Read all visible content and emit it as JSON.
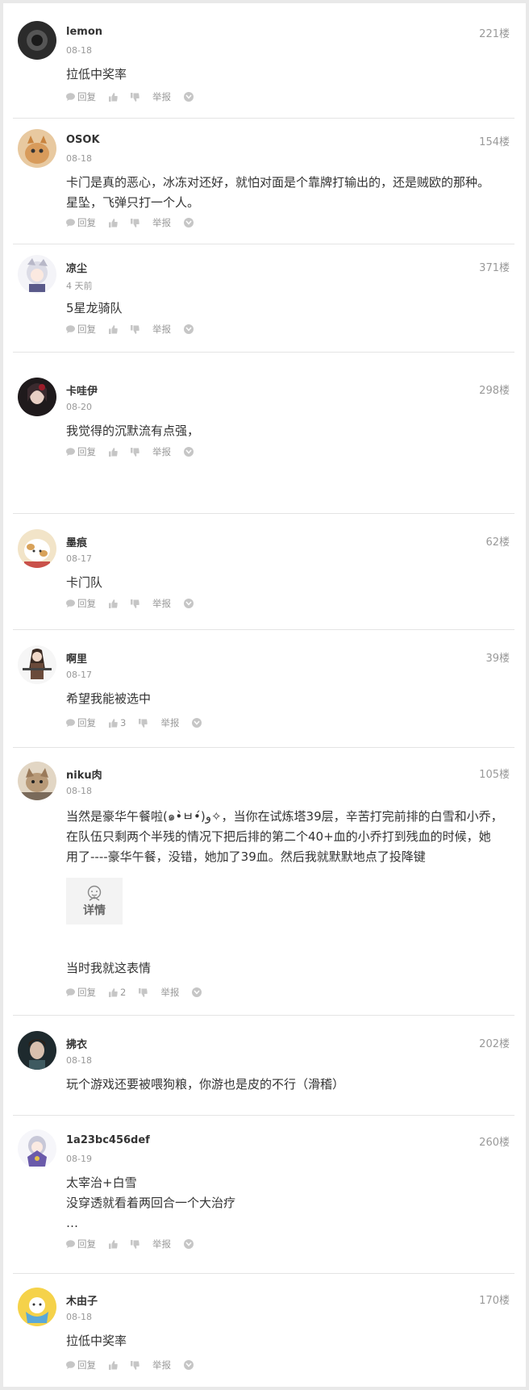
{
  "labels": {
    "reply": "回复",
    "report": "举报",
    "detail": "详情"
  },
  "comments": [
    {
      "name": "lemon",
      "date": "08-18",
      "floor": "221楼",
      "lines": [
        "拉低中奖率"
      ],
      "likes": ""
    },
    {
      "name": "OSOK",
      "date": "08-18",
      "floor": "154楼",
      "lines": [
        "卡门是真的恶心，冰冻对还好，就怕对面是个靠牌打输出的，还是贼欧的那种。",
        "星坠，飞弹只打一个人。"
      ],
      "likes": ""
    },
    {
      "name": "凉尘",
      "date": "4 天前",
      "floor": "371楼",
      "lines": [
        "5星龙骑队"
      ],
      "likes": ""
    },
    {
      "name": "卡哇伊",
      "date": "08-20",
      "floor": "298楼",
      "lines": [
        "我觉得的沉默流有点强，"
      ],
      "likes": ""
    },
    {
      "name": "墨痕",
      "date": "08-17",
      "floor": "62楼",
      "lines": [
        "卡门队"
      ],
      "likes": ""
    },
    {
      "name": "啊里",
      "date": "08-17",
      "floor": "39楼",
      "lines": [
        "希望我能被选中"
      ],
      "likes": "3"
    },
    {
      "name": "niku肉",
      "date": "08-18",
      "floor": "105楼",
      "lines": [
        "当然是豪华午餐啦(๑•̀ㅂ•́)و✧，当你在试炼塔39层，辛苦打完前排的白雪和小乔，",
        "在队伍只剩两个半残的情况下把后排的第二个40+血的小乔打到残血的时候，她",
        "用了----豪华午餐，没错，她加了39血。然后我就默默地点了投降键"
      ],
      "after": "当时我就这表情",
      "likes": "2"
    },
    {
      "name": "拂衣",
      "date": "08-18",
      "floor": "202楼",
      "lines": [
        "玩个游戏还要被喂狗粮，你游也是皮的不行（滑稽）"
      ],
      "likes": ""
    },
    {
      "name": "1a23bc456def",
      "date": "08-19",
      "floor": "260楼",
      "lines": [
        "太宰治+白雪",
        "没穿透就看着两回合一个大治疗",
        "…"
      ],
      "likes": ""
    },
    {
      "name": "木由子",
      "date": "08-18",
      "floor": "170楼",
      "lines": [
        "拉低中奖率"
      ],
      "likes": ""
    }
  ],
  "colors": {
    "text": "#333333",
    "meta": "#999999",
    "divider": "#e4e4e4"
  }
}
